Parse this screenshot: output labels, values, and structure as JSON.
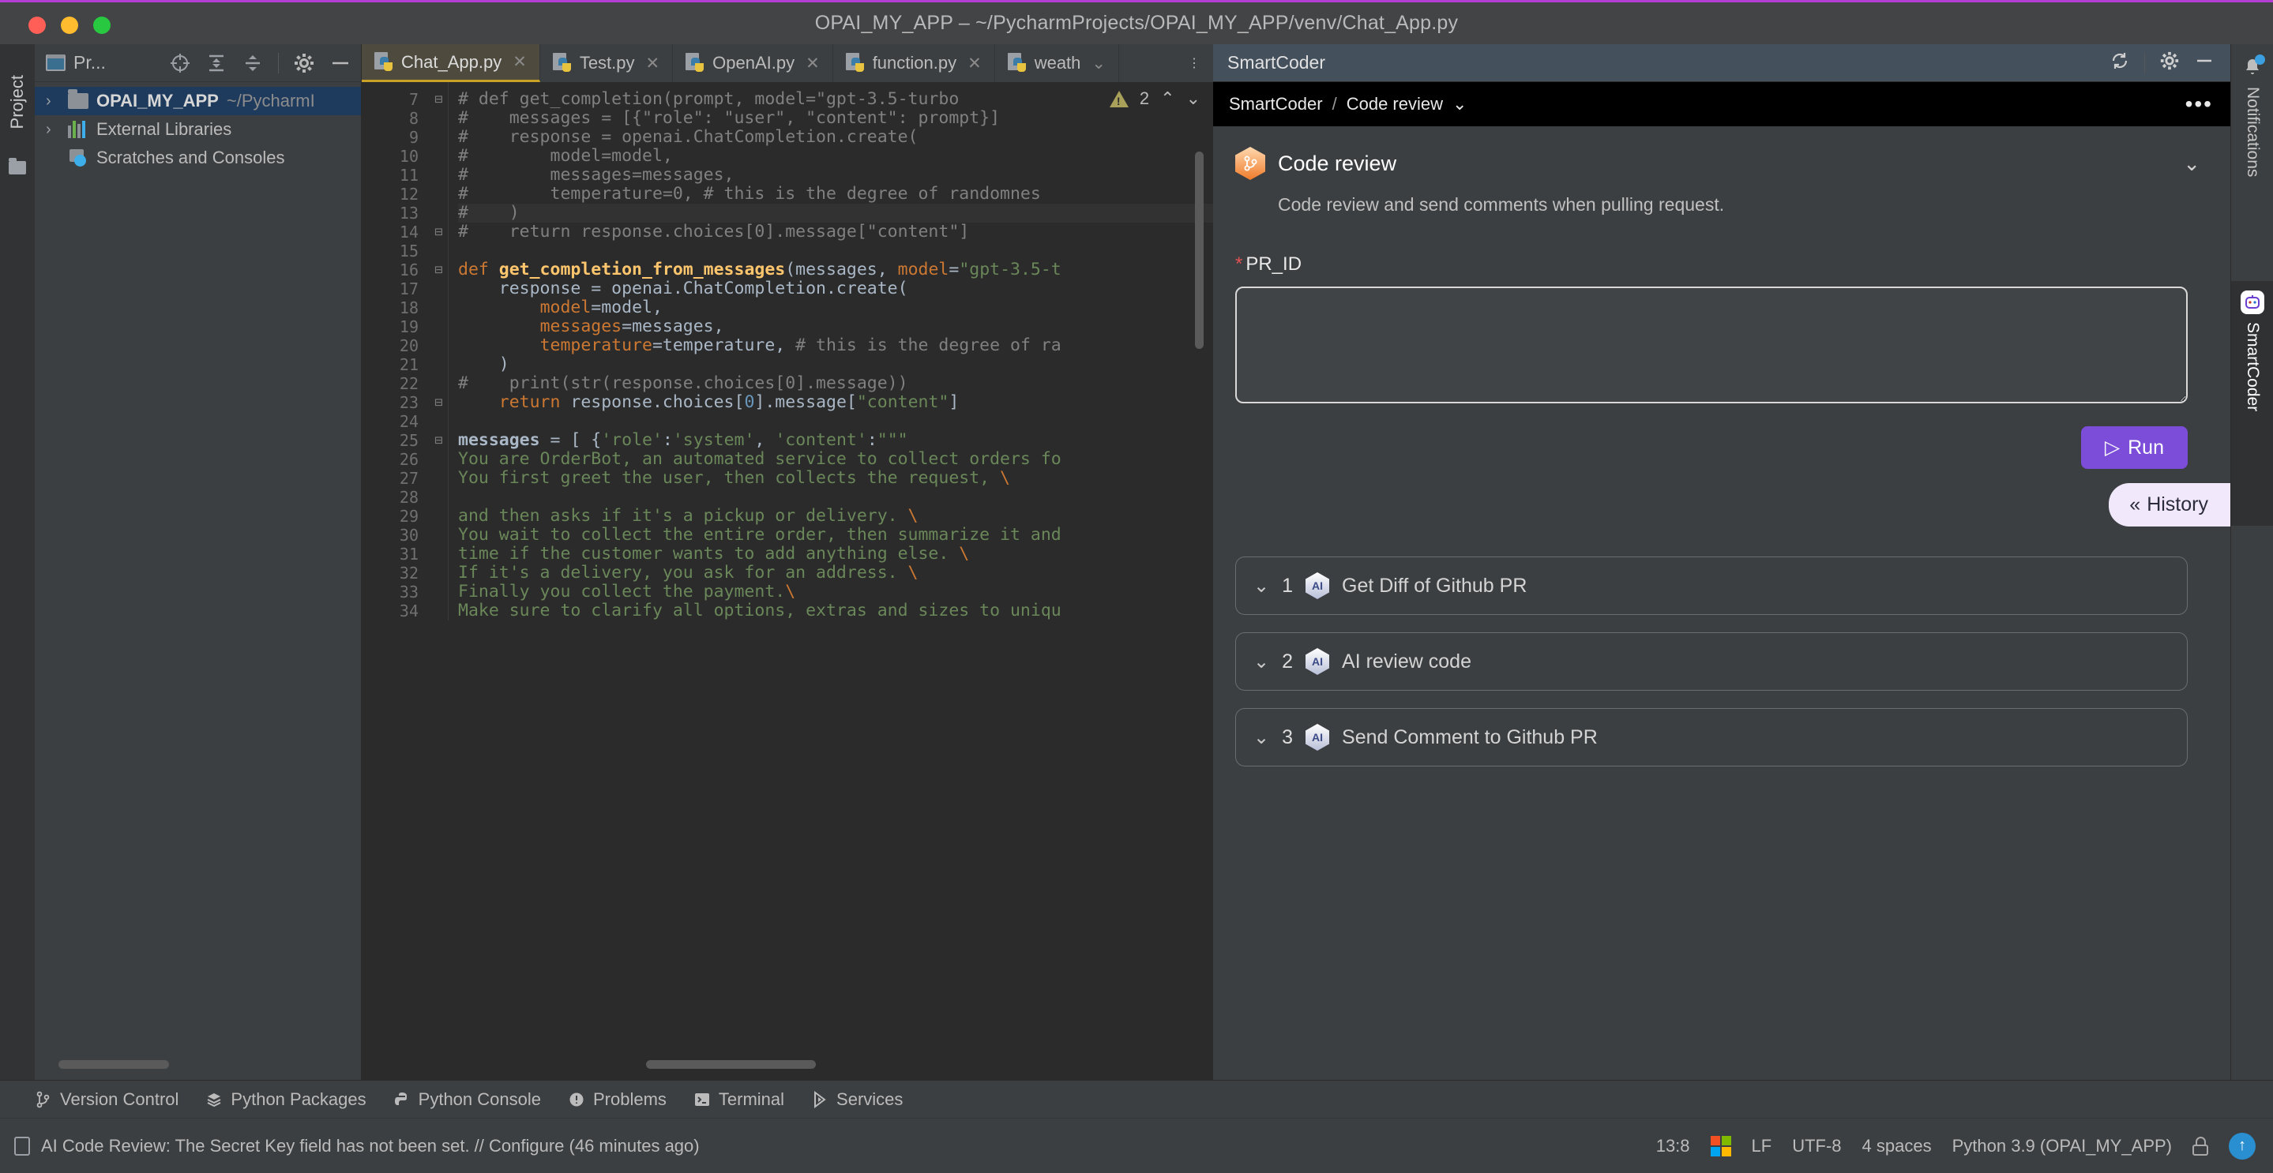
{
  "window": {
    "title": "OPAI_MY_APP – ~/PycharmProjects/OPAI_MY_APP/venv/Chat_App.py"
  },
  "left_rail": {
    "project_tab": "Project"
  },
  "project_panel": {
    "title": "Pr...",
    "tree": [
      {
        "label": "OPAI_MY_APP",
        "path": "~/PycharmI",
        "icon": "folder-icon",
        "selected": true
      },
      {
        "label": "External Libraries",
        "path": "",
        "icon": "library-icon",
        "selected": false
      },
      {
        "label": "Scratches and Consoles",
        "path": "",
        "icon": "scratches-icon",
        "selected": false
      }
    ]
  },
  "editor": {
    "tabs": [
      {
        "label": "Chat_App.py",
        "active": true,
        "closable": true
      },
      {
        "label": "Test.py",
        "active": false,
        "closable": true
      },
      {
        "label": "OpenAI.py",
        "active": false,
        "closable": true
      },
      {
        "label": "function.py",
        "active": false,
        "closable": true
      },
      {
        "label": "weath",
        "active": false,
        "closable": false
      }
    ],
    "warning_count": "2",
    "lines": [
      {
        "n": "7",
        "fold": "⊟",
        "html": "<span class='c-com'># def get_completion(prompt, model=\"gpt-3.5-turbo</span>"
      },
      {
        "n": "8",
        "fold": "",
        "html": "<span class='c-com'>#    messages = [{\"role\": \"user\", \"content\": prompt}]</span>"
      },
      {
        "n": "9",
        "fold": "",
        "html": "<span class='c-com'>#    response = openai.ChatCompletion.create(</span>"
      },
      {
        "n": "10",
        "fold": "",
        "html": "<span class='c-com'>#        model=model,</span>"
      },
      {
        "n": "11",
        "fold": "",
        "html": "<span class='c-com'>#        messages=messages,</span>"
      },
      {
        "n": "12",
        "fold": "",
        "html": "<span class='c-com'>#        temperature=0, # this is the degree of randomnes</span>"
      },
      {
        "n": "13",
        "fold": "",
        "html": "<span class='c-com'>#    )</span>",
        "current": true
      },
      {
        "n": "14",
        "fold": "⊟",
        "html": "<span class='c-com'>#    return response.choices[0].message[\"content\"]</span>"
      },
      {
        "n": "15",
        "fold": "",
        "html": ""
      },
      {
        "n": "16",
        "fold": "⊟",
        "html": "<span class='c-kw'>def </span><span class='c-fn'>get_completion_from_messages</span>(<span class='c-par'>messages</span>, <span class='c-kwa'>model</span>=<span class='c-str'>\"gpt-3.5-t</span>"
      },
      {
        "n": "17",
        "fold": "",
        "html": "    response = openai.ChatCompletion.create("
      },
      {
        "n": "18",
        "fold": "",
        "html": "        <span class='c-kwa'>model</span>=model,"
      },
      {
        "n": "19",
        "fold": "",
        "html": "        <span class='c-kwa'>messages</span>=messages,"
      },
      {
        "n": "20",
        "fold": "",
        "html": "        <span class='c-kwa'>temperature</span>=temperature, <span class='c-com'># this is the degree of ra</span>"
      },
      {
        "n": "21",
        "fold": "",
        "html": "    )"
      },
      {
        "n": "22",
        "fold": "",
        "html": "<span class='c-com'>#    print(str(response.choices[0].message))</span>"
      },
      {
        "n": "23",
        "fold": "⊟",
        "html": "    <span class='c-kw'>return</span> response.choices[<span class='c-num'>0</span>].message[<span class='c-str'>\"content\"</span>]"
      },
      {
        "n": "24",
        "fold": "",
        "html": ""
      },
      {
        "n": "25",
        "fold": "⊟",
        "html": "<span class='c-bold'>messages</span> = [ {<span class='c-str'>'role'</span>:<span class='c-str'>'system'</span>, <span class='c-str'>'content'</span>:<span class='c-str'>\"\"\"</span>"
      },
      {
        "n": "26",
        "fold": "",
        "html": "<span class='c-str'>You are OrderBot, an automated service to collect orders fo</span>"
      },
      {
        "n": "27",
        "fold": "",
        "html": "<span class='c-str'>You first greet the user, then collects the request, </span><span class='c-kw'>\\</span>"
      },
      {
        "n": "28",
        "fold": "",
        "html": ""
      },
      {
        "n": "29",
        "fold": "",
        "html": "<span class='c-str'>and then asks if it's a pickup or delivery. </span><span class='c-kw'>\\</span>"
      },
      {
        "n": "30",
        "fold": "",
        "html": "<span class='c-str'>You wait to collect the entire order, then summarize it and</span>"
      },
      {
        "n": "31",
        "fold": "",
        "html": "<span class='c-str'>time if the customer wants to add anything else. </span><span class='c-kw'>\\</span>"
      },
      {
        "n": "32",
        "fold": "",
        "html": "<span class='c-str'>If it's a delivery, you ask for an address. </span><span class='c-kw'>\\</span>"
      },
      {
        "n": "33",
        "fold": "",
        "html": "<span class='c-str'>Finally you collect the payment.</span><span class='c-kw'>\\</span>"
      },
      {
        "n": "34",
        "fold": "",
        "html": "<span class='c-str'>Make sure to clarify all options, extras and sizes to uniqu</span>"
      }
    ]
  },
  "smartcoder": {
    "header_title": "SmartCoder",
    "breadcrumb": {
      "root": "SmartCoder",
      "sep": "/",
      "current": "Code review",
      "chevron": "⌄"
    },
    "more_dots": "•••",
    "card": {
      "title": "Code review",
      "description": "Code review and send comments when pulling request.",
      "collapse_chevron": "⌄"
    },
    "field": {
      "required_mark": "*",
      "label": "PR_ID",
      "value": "",
      "placeholder": ""
    },
    "run_button": "Run",
    "history_button": "History",
    "steps": [
      {
        "chevron": "⌄",
        "num": "1",
        "badge": "AI",
        "label": "Get Diff of Github PR"
      },
      {
        "chevron": "⌄",
        "num": "2",
        "badge": "AI",
        "label": "AI review code"
      },
      {
        "chevron": "⌄",
        "num": "3",
        "badge": "AI",
        "label": "Send Comment to Github PR"
      }
    ]
  },
  "right_rail": {
    "notifications": "Notifications",
    "smartcoder": "SmartCoder"
  },
  "bottom_bar": {
    "items": [
      {
        "label": "Version Control",
        "icon": "branch-icon"
      },
      {
        "label": "Python Packages",
        "icon": "packages-icon"
      },
      {
        "label": "Python Console",
        "icon": "python-icon"
      },
      {
        "label": "Problems",
        "icon": "problems-icon"
      },
      {
        "label": "Terminal",
        "icon": "terminal-icon"
      },
      {
        "label": "Services",
        "icon": "services-icon"
      }
    ]
  },
  "status_bar": {
    "message": "AI Code Review: The Secret Key field has not been set. // Configure (46 minutes ago)",
    "caret": "13:8",
    "line_sep": "LF",
    "encoding": "UTF-8",
    "indent": "4 spaces",
    "interpreter": "Python 3.9 (OPAI_MY_APP)"
  },
  "colors": {
    "accent_purple": "#7c4dd8",
    "title_accent": "#b43fd4",
    "panel_header": "#44505c",
    "tab_active": "#4e4a3e",
    "tab_active_underline": "#c9a227",
    "tree_selected": "#1e3a5c",
    "required_red": "#e05252",
    "string_green": "#6a8759",
    "keyword_orange": "#cc7832",
    "function_yellow": "#ffc66d"
  }
}
